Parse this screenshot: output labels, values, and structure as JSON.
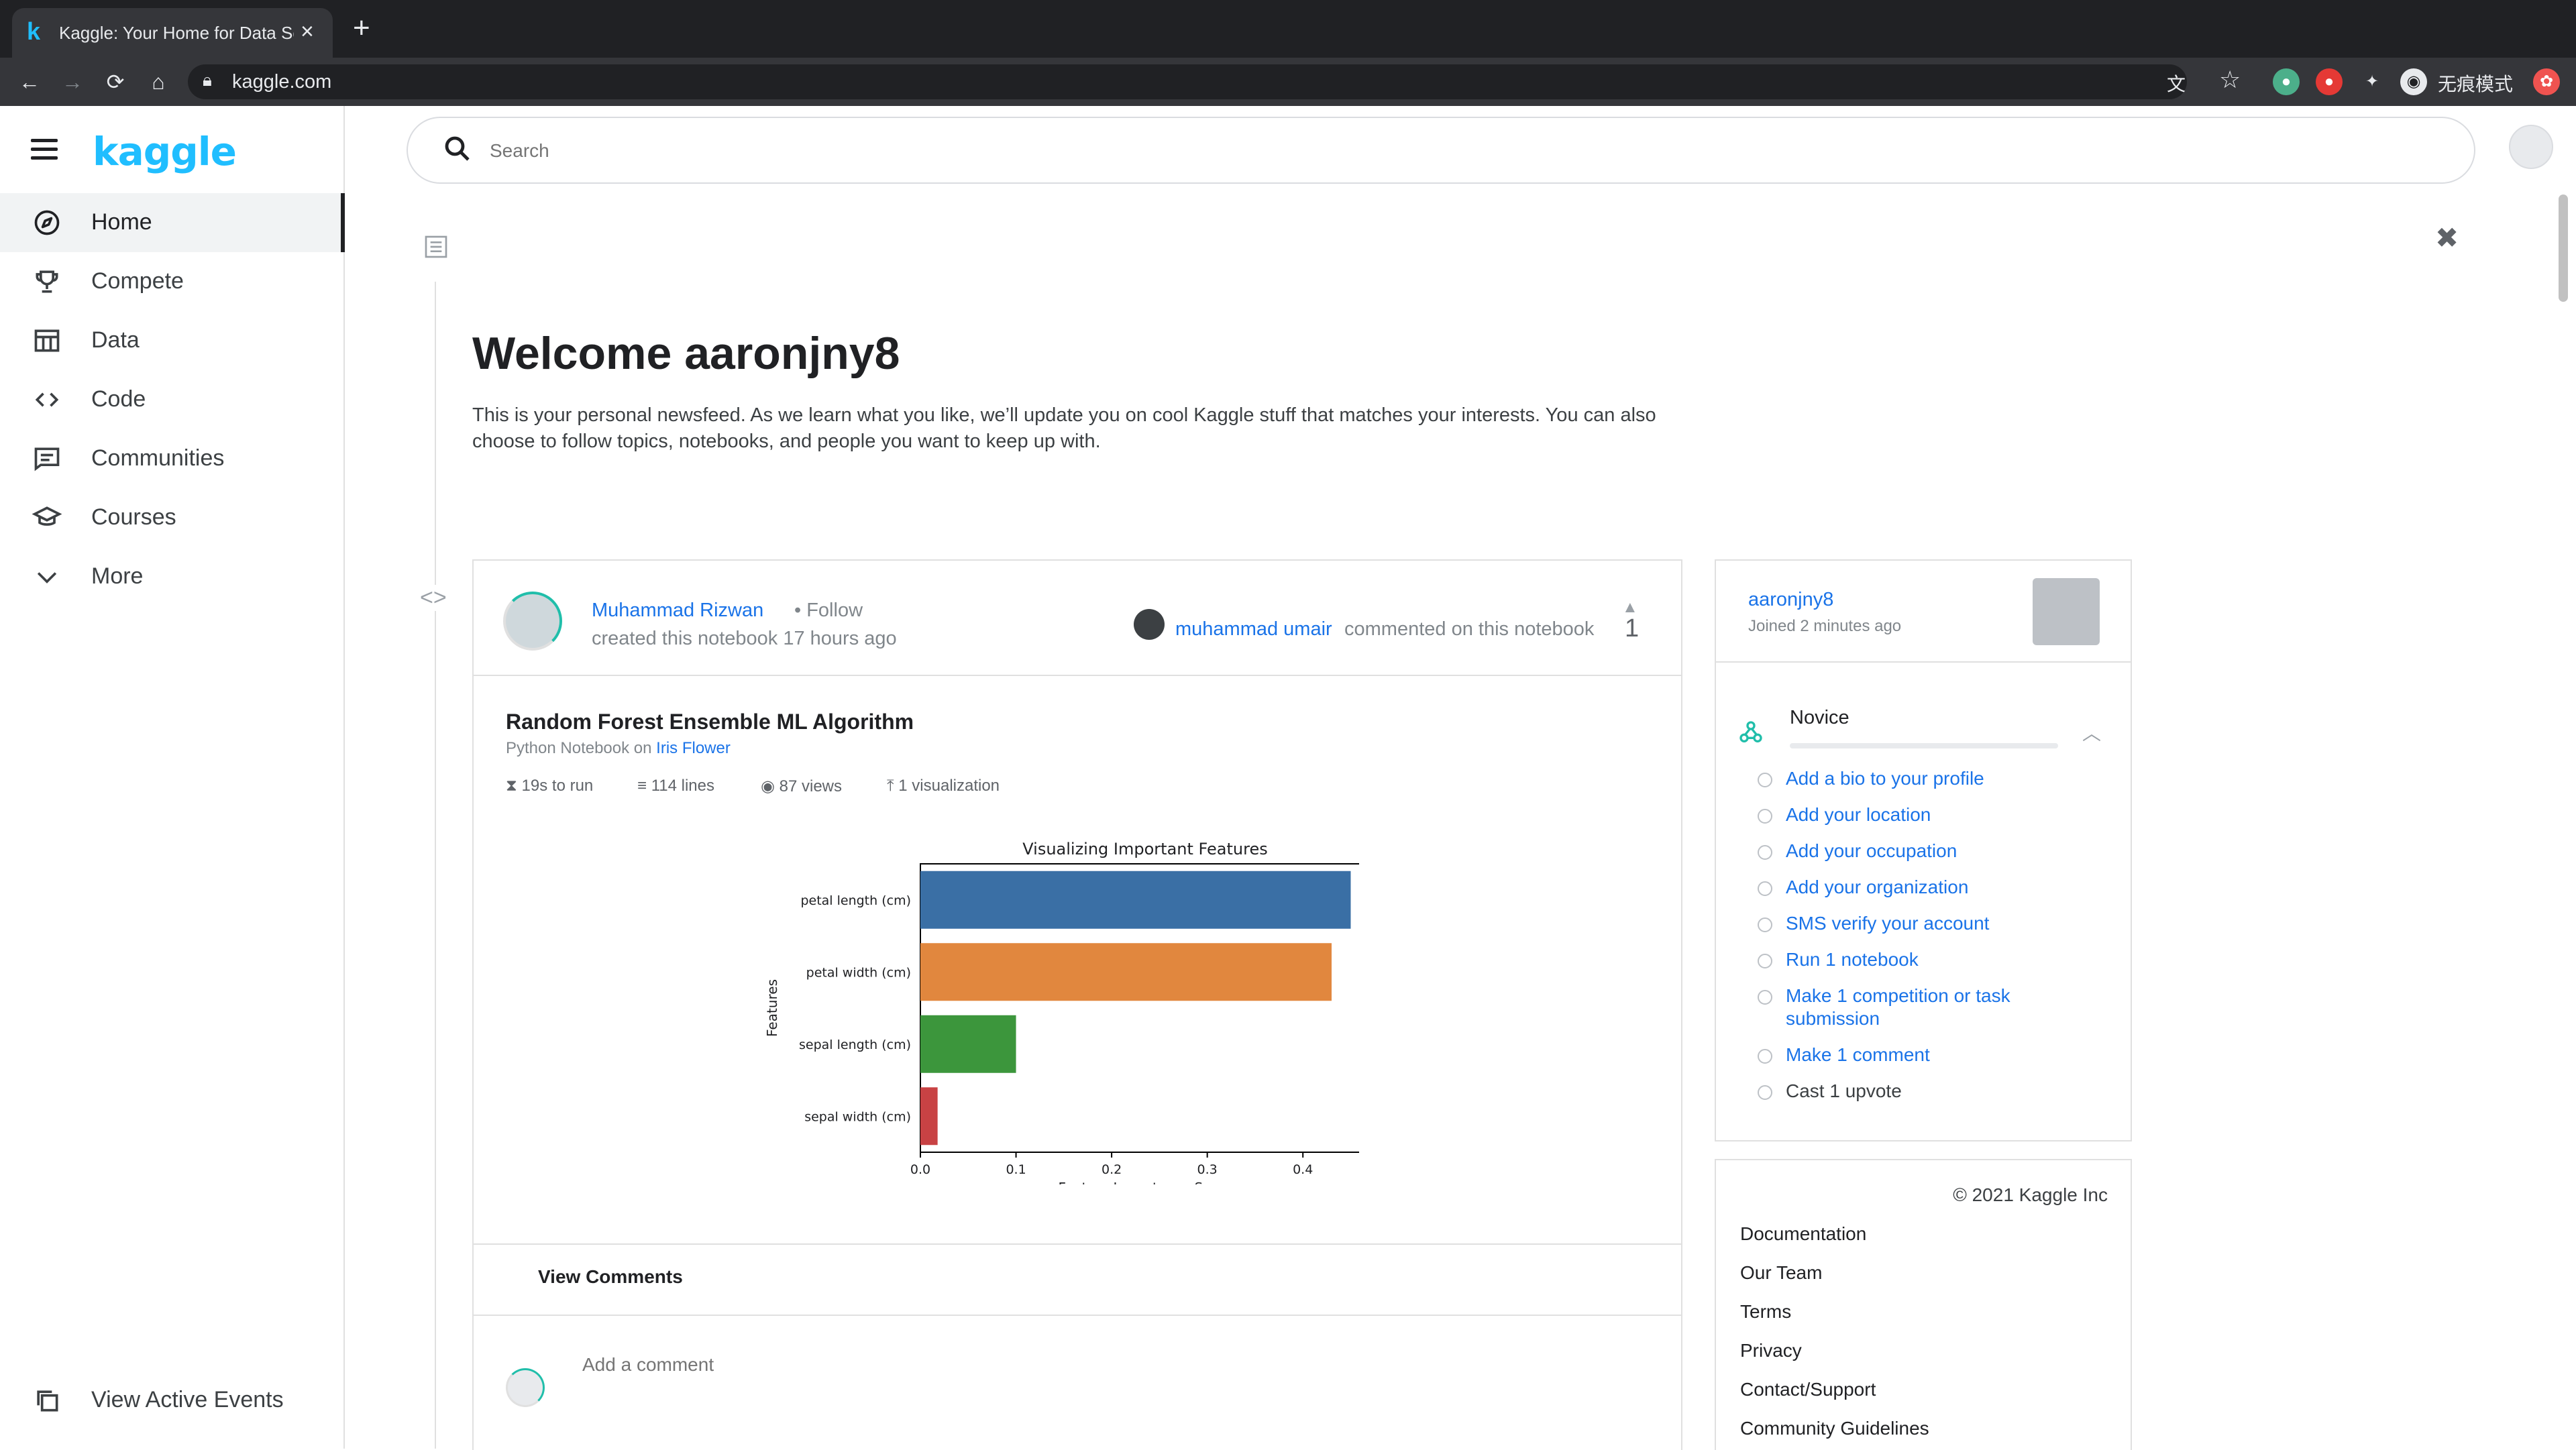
{
  "browser": {
    "tab_title": "Kaggle: Your Home for Data Science",
    "tab_icon": "k",
    "url": "kaggle.com",
    "incognito_label": "无痕模式"
  },
  "sidebar": {
    "logo": "kaggle",
    "items": [
      {
        "label": "Home",
        "icon": "compass-icon"
      },
      {
        "label": "Compete",
        "icon": "trophy-icon"
      },
      {
        "label": "Data",
        "icon": "table-icon"
      },
      {
        "label": "Code",
        "icon": "code-icon"
      },
      {
        "label": "Communities",
        "icon": "comments-icon"
      },
      {
        "label": "Courses",
        "icon": "graduation-cap-icon"
      },
      {
        "label": "More",
        "icon": "chevron-down-icon"
      }
    ],
    "view_events": "View Active Events"
  },
  "search": {
    "placeholder": "Search"
  },
  "welcome": {
    "title": "Welcome aaronjny8",
    "text": "This is your personal newsfeed. As we learn what you like, we’ll update you on cool Kaggle stuff that matches your interests. You can also choose to follow topics, notebooks, and people you want to keep up with."
  },
  "post": {
    "author": "Muhammad Rizwan",
    "follow": "Follow",
    "created": "created this notebook 17 hours ago",
    "commenter": "muhammad umair",
    "commented": "commented on this notebook",
    "votes": "1",
    "title": "Random Forest Ensemble ML Algorithm",
    "subtitle_prefix": "Python Notebook on",
    "dataset": "Iris Flower",
    "meta": {
      "runtime": "19s to run",
      "lines": "114 lines",
      "views": "87 views",
      "visualizations": "1 visualization"
    },
    "view_comments": "View Comments",
    "comment_placeholder": "Add a comment"
  },
  "chart_data": {
    "type": "bar",
    "orientation": "horizontal",
    "title": "Visualizing Important Features",
    "xlabel": "Feature Importance Score",
    "ylabel": "Features",
    "categories": [
      "petal length (cm)",
      "petal width (cm)",
      "sepal length (cm)",
      "sepal width (cm)"
    ],
    "values": [
      0.45,
      0.43,
      0.1,
      0.018
    ],
    "colors": [
      "#3a6fa5",
      "#e1873e",
      "#3c963c",
      "#c84244"
    ],
    "xlim": [
      0,
      0.47
    ],
    "xticks": [
      "0.0",
      "0.1",
      "0.2",
      "0.3",
      "0.4"
    ],
    "grid": false
  },
  "profile": {
    "username": "aaronjny8",
    "joined": "Joined 2 minutes ago",
    "tier": "Novice",
    "tier_progress": 0.0,
    "tasks": [
      {
        "label": "Add a bio to your profile",
        "done": false
      },
      {
        "label": "Add your location",
        "done": false
      },
      {
        "label": "Add your occupation",
        "done": false
      },
      {
        "label": "Add your organization",
        "done": false
      },
      {
        "label": "SMS verify your account",
        "done": false
      },
      {
        "label": "Run 1 notebook",
        "done": false
      },
      {
        "label": "Make 1 competition or task submission",
        "done": false
      },
      {
        "label": "Make 1 comment",
        "done": false
      },
      {
        "label": "Cast 1 upvote",
        "done": true
      }
    ]
  },
  "footer": {
    "copyright": "© 2021 Kaggle Inc",
    "links": [
      "Documentation",
      "Our Team",
      "Terms",
      "Privacy",
      "Contact/Support",
      "Community Guidelines"
    ]
  }
}
